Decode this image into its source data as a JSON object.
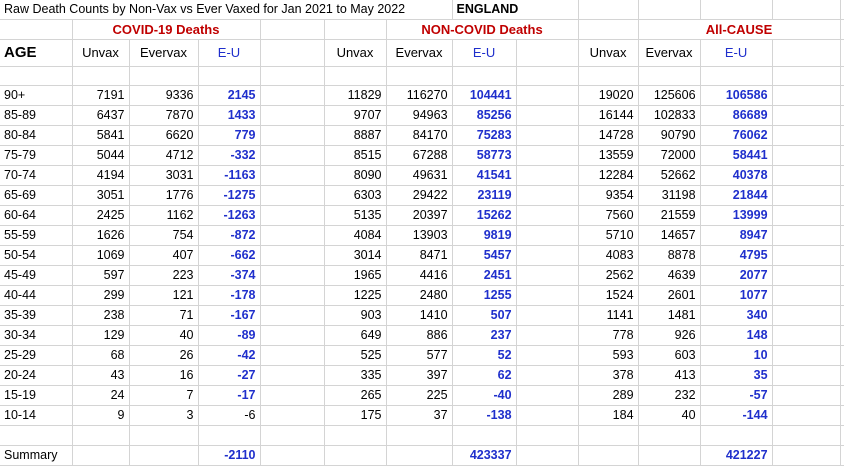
{
  "title": "Raw Death Counts by Non-Vax vs Ever Vaxed for Jan 2021 to May 2022",
  "region": "ENGLAND",
  "sections": {
    "covid": "COVID-19 Deaths",
    "noncovid": "NON-COVID Deaths",
    "allcause": "All-CAUSE"
  },
  "headers": {
    "age": "AGE",
    "unvax": "Unvax",
    "evervax": "Evervax",
    "eu": "E-U"
  },
  "rows": [
    {
      "age": "90+",
      "c_u": "7191",
      "c_e": "9336",
      "c_d": "2145",
      "n_u": "11829",
      "n_e": "116270",
      "n_d": "104441",
      "a_u": "19020",
      "a_e": "125606",
      "a_d": "106586"
    },
    {
      "age": "85-89",
      "c_u": "6437",
      "c_e": "7870",
      "c_d": "1433",
      "n_u": "9707",
      "n_e": "94963",
      "n_d": "85256",
      "a_u": "16144",
      "a_e": "102833",
      "a_d": "86689"
    },
    {
      "age": "80-84",
      "c_u": "5841",
      "c_e": "6620",
      "c_d": "779",
      "n_u": "8887",
      "n_e": "84170",
      "n_d": "75283",
      "a_u": "14728",
      "a_e": "90790",
      "a_d": "76062"
    },
    {
      "age": "75-79",
      "c_u": "5044",
      "c_e": "4712",
      "c_d": "-332",
      "n_u": "8515",
      "n_e": "67288",
      "n_d": "58773",
      "a_u": "13559",
      "a_e": "72000",
      "a_d": "58441"
    },
    {
      "age": "70-74",
      "c_u": "4194",
      "c_e": "3031",
      "c_d": "-1163",
      "n_u": "8090",
      "n_e": "49631",
      "n_d": "41541",
      "a_u": "12284",
      "a_e": "52662",
      "a_d": "40378"
    },
    {
      "age": "65-69",
      "c_u": "3051",
      "c_e": "1776",
      "c_d": "-1275",
      "n_u": "6303",
      "n_e": "29422",
      "n_d": "23119",
      "a_u": "9354",
      "a_e": "31198",
      "a_d": "21844"
    },
    {
      "age": "60-64",
      "c_u": "2425",
      "c_e": "1162",
      "c_d": "-1263",
      "n_u": "5135",
      "n_e": "20397",
      "n_d": "15262",
      "a_u": "7560",
      "a_e": "21559",
      "a_d": "13999"
    },
    {
      "age": "55-59",
      "c_u": "1626",
      "c_e": "754",
      "c_d": "-872",
      "n_u": "4084",
      "n_e": "13903",
      "n_d": "9819",
      "a_u": "5710",
      "a_e": "14657",
      "a_d": "8947"
    },
    {
      "age": "50-54",
      "c_u": "1069",
      "c_e": "407",
      "c_d": "-662",
      "n_u": "3014",
      "n_e": "8471",
      "n_d": "5457",
      "a_u": "4083",
      "a_e": "8878",
      "a_d": "4795"
    },
    {
      "age": "45-49",
      "c_u": "597",
      "c_e": "223",
      "c_d": "-374",
      "n_u": "1965",
      "n_e": "4416",
      "n_d": "2451",
      "a_u": "2562",
      "a_e": "4639",
      "a_d": "2077"
    },
    {
      "age": "40-44",
      "c_u": "299",
      "c_e": "121",
      "c_d": "-178",
      "n_u": "1225",
      "n_e": "2480",
      "n_d": "1255",
      "a_u": "1524",
      "a_e": "2601",
      "a_d": "1077"
    },
    {
      "age": "35-39",
      "c_u": "238",
      "c_e": "71",
      "c_d": "-167",
      "n_u": "903",
      "n_e": "1410",
      "n_d": "507",
      "a_u": "1141",
      "a_e": "1481",
      "a_d": "340"
    },
    {
      "age": "30-34",
      "c_u": "129",
      "c_e": "40",
      "c_d": "-89",
      "n_u": "649",
      "n_e": "886",
      "n_d": "237",
      "a_u": "778",
      "a_e": "926",
      "a_d": "148"
    },
    {
      "age": "25-29",
      "c_u": "68",
      "c_e": "26",
      "c_d": "-42",
      "n_u": "525",
      "n_e": "577",
      "n_d": "52",
      "a_u": "593",
      "a_e": "603",
      "a_d": "10"
    },
    {
      "age": "20-24",
      "c_u": "43",
      "c_e": "16",
      "c_d": "-27",
      "n_u": "335",
      "n_e": "397",
      "n_d": "62",
      "a_u": "378",
      "a_e": "413",
      "a_d": "35"
    },
    {
      "age": "15-19",
      "c_u": "24",
      "c_e": "7",
      "c_d": "-17",
      "n_u": "265",
      "n_e": "225",
      "n_d": "-40",
      "a_u": "289",
      "a_e": "232",
      "a_d": "-57"
    },
    {
      "age": "10-14",
      "c_u": "9",
      "c_e": "3",
      "c_d": "-6",
      "n_u": "175",
      "n_e": "37",
      "n_d": "-138",
      "a_u": "184",
      "a_e": "40",
      "a_d": "-144"
    }
  ],
  "summary": {
    "label": "Summary",
    "covid_diff": "-2110",
    "noncovid_diff": "423337",
    "allcause_diff": "421227"
  }
}
